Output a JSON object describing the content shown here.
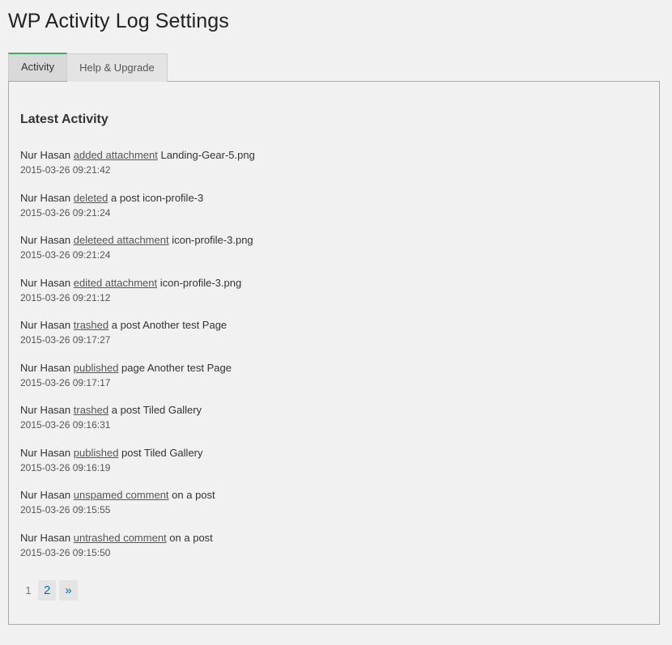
{
  "page": {
    "title": "WP Activity Log Settings"
  },
  "tabs": [
    {
      "label": "Activity",
      "active": true
    },
    {
      "label": "Help & Upgrade",
      "active": false
    }
  ],
  "section": {
    "title": "Latest Activity"
  },
  "activities": [
    {
      "user": "Nur Hasan",
      "action": "added attachment",
      "middle": "",
      "target": "Landing-Gear-5.png",
      "time": "2015-03-26 09:21:42"
    },
    {
      "user": "Nur Hasan",
      "action": "deleted",
      "middle": "a post",
      "target": "icon-profile-3",
      "time": "2015-03-26 09:21:24"
    },
    {
      "user": "Nur Hasan",
      "action": "deleteed attachment",
      "middle": "",
      "target": "icon-profile-3.png",
      "time": "2015-03-26 09:21:24"
    },
    {
      "user": "Nur Hasan",
      "action": "edited attachment",
      "middle": "",
      "target": "icon-profile-3.png",
      "time": "2015-03-26 09:21:12"
    },
    {
      "user": "Nur Hasan",
      "action": "trashed",
      "middle": "a post",
      "target": "Another test Page",
      "time": "2015-03-26 09:17:27"
    },
    {
      "user": "Nur Hasan",
      "action": "published",
      "middle": "page",
      "target": "Another test Page",
      "time": "2015-03-26 09:17:17"
    },
    {
      "user": "Nur Hasan",
      "action": "trashed",
      "middle": "a post",
      "target": "Tiled Gallery",
      "time": "2015-03-26 09:16:31"
    },
    {
      "user": "Nur Hasan",
      "action": "published",
      "middle": "post",
      "target": "Tiled Gallery",
      "time": "2015-03-26 09:16:19"
    },
    {
      "user": "Nur Hasan",
      "action": "unspamed comment",
      "middle": "on a post",
      "target": "",
      "time": "2015-03-26 09:15:55"
    },
    {
      "user": "Nur Hasan",
      "action": "untrashed comment",
      "middle": "on a post",
      "target": "",
      "time": "2015-03-26 09:15:50"
    }
  ],
  "pagination": {
    "current": "1",
    "links": [
      "2",
      "»"
    ]
  },
  "colors": {
    "background": "#f1f1f1",
    "active_tab_border": "#3fa86a",
    "link": "#0073aa"
  }
}
